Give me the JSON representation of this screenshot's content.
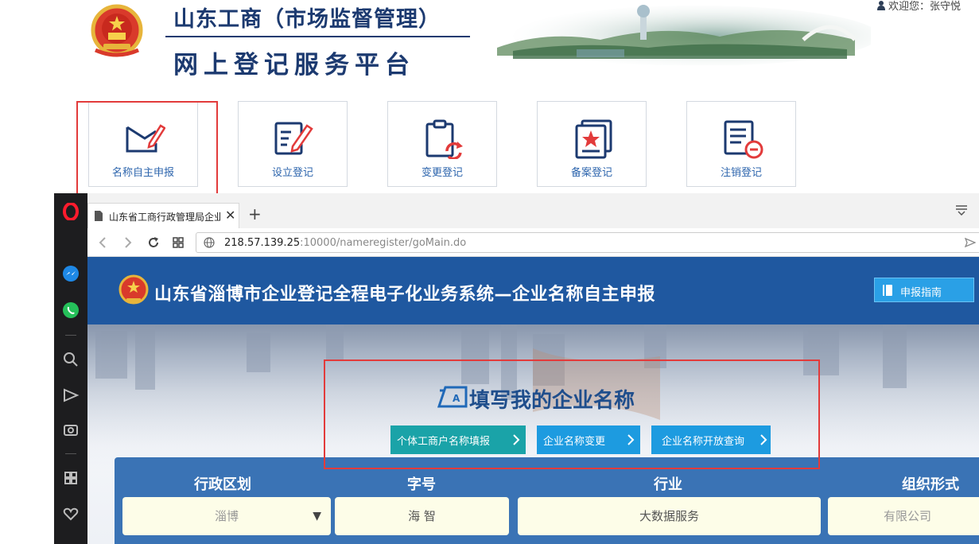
{
  "header": {
    "title_line1": "山东工商（市场监督管理）",
    "title_line2": "网上登记服务平台",
    "welcome_label": "欢迎您：",
    "user_name": "张守悦"
  },
  "tiles": [
    {
      "label": "名称自主申报"
    },
    {
      "label": "设立登记"
    },
    {
      "label": "变更登记"
    },
    {
      "label": "备案登记"
    },
    {
      "label": "注销登记"
    }
  ],
  "browser": {
    "tab_title": "山东省工商行政管理局企业",
    "url_host": "218.57.139.25",
    "url_rest": ":10000/nameregister/goMain.do",
    "new_tab": "+",
    "close_tab": "✕"
  },
  "webpage": {
    "banner_title": "山东省淄博市企业登记全程电子化业务系统—企业名称自主申报",
    "guide_button": "申报指南",
    "fill_title": "填写我的企业名称",
    "actions": [
      {
        "label": "个体工商户名称填报",
        "color": "#1aa3a8"
      },
      {
        "label": "企业名称变更",
        "color": "#1d9be0"
      },
      {
        "label": "企业名称开放查询",
        "color": "#1d9be0"
      }
    ],
    "form": {
      "columns": [
        "行政区划",
        "字号",
        "行业",
        "组织形式"
      ],
      "region_value": "淄博",
      "name_value": "海 智",
      "industry_value": "大数据服务",
      "org_form_value": "有限公司"
    }
  },
  "colors": {
    "accent_blue": "#1f58a0",
    "highlight_red": "#e23b3b",
    "tile_text": "#2d65ad"
  }
}
